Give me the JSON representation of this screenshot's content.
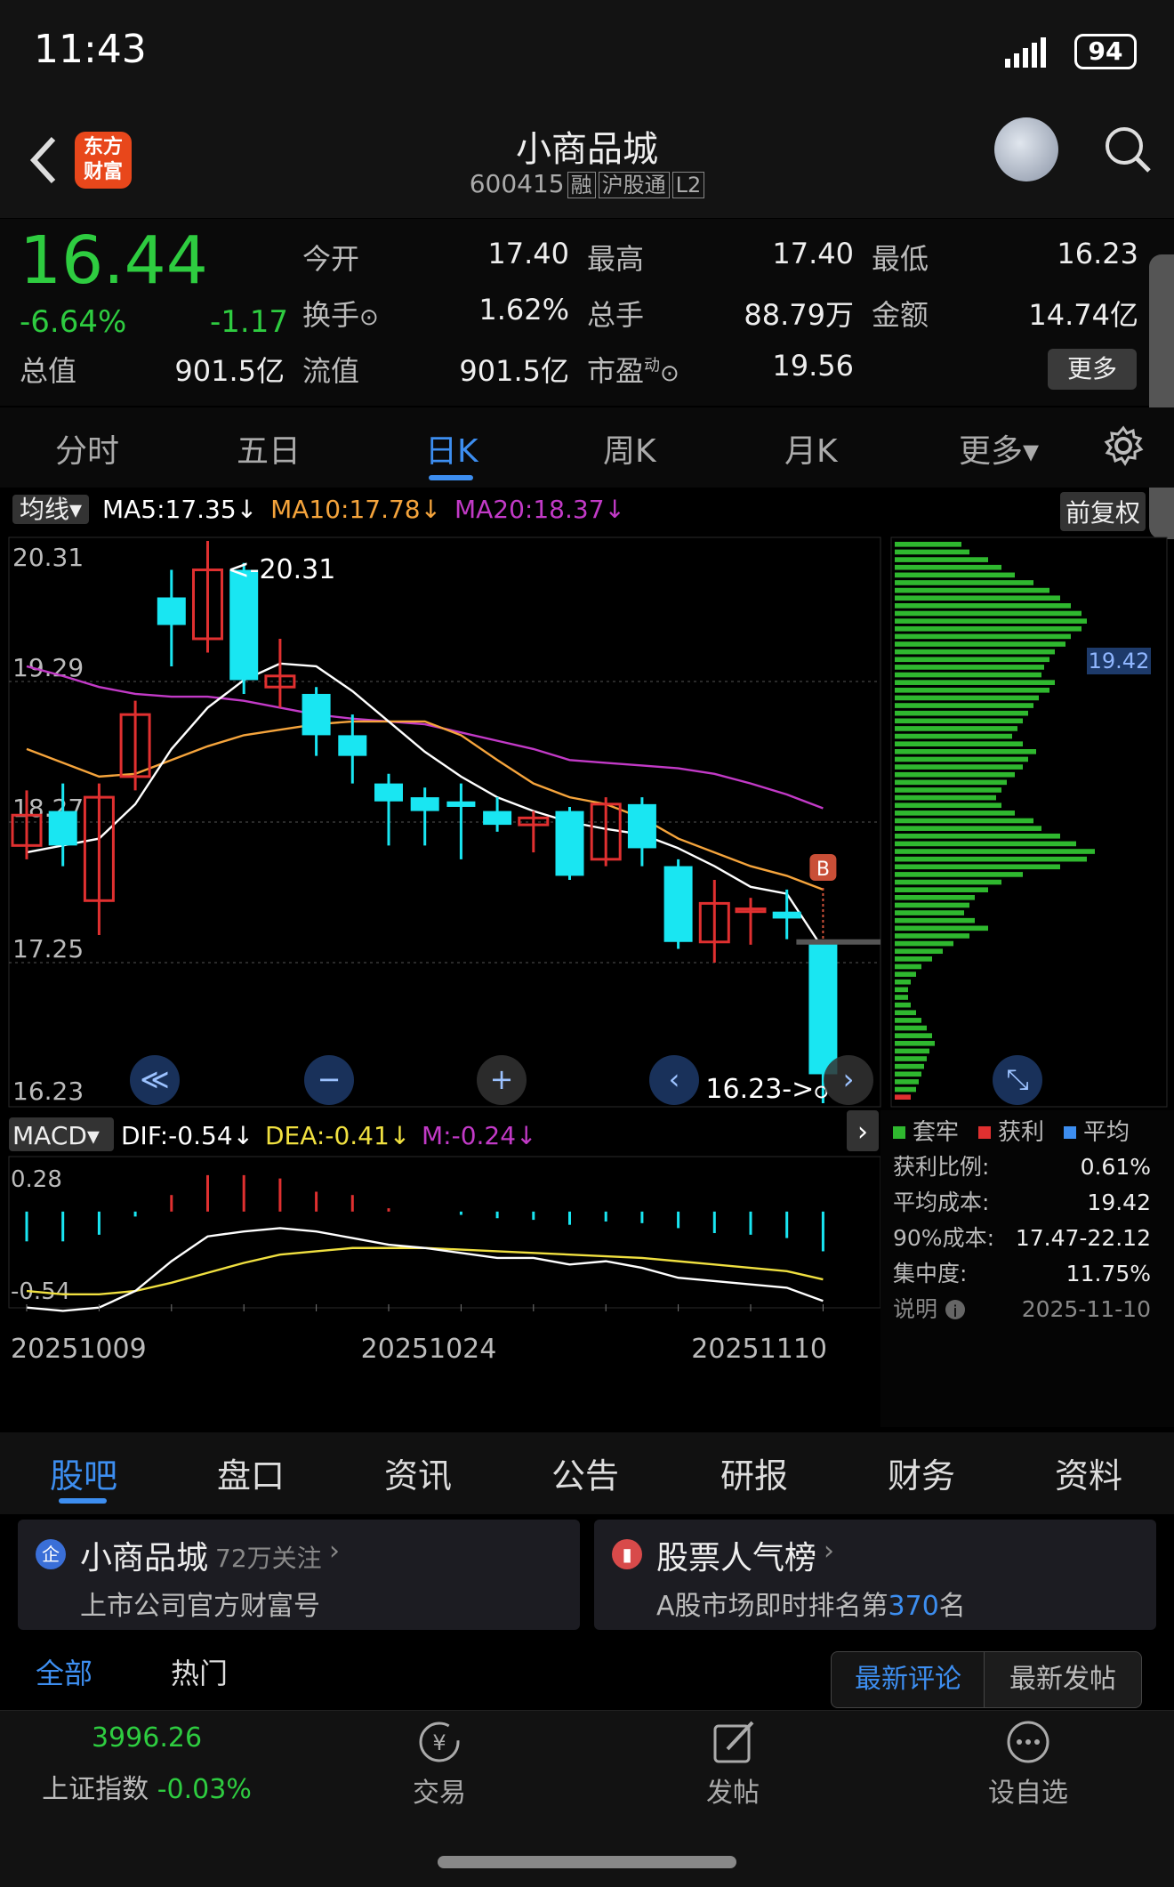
{
  "status_bar": {
    "time": "11:43",
    "battery": "94"
  },
  "header": {
    "name": "小商品城",
    "code": "600415",
    "tags": [
      "融",
      "沪股通",
      "L2"
    ],
    "logo_text": "东方财富"
  },
  "quote": {
    "price": "16.44",
    "change_pct": "-6.64%",
    "change": "-1.17",
    "open_label": "今开",
    "open": "17.40",
    "high_label": "最高",
    "high": "17.40",
    "low_label": "最低",
    "low": "16.23",
    "turnover_label": "换手",
    "turnover": "1.62%",
    "volume_label": "总手",
    "volume": "88.79万",
    "amount_label": "金额",
    "amount": "14.74亿",
    "mktcap_label": "总值",
    "mktcap": "901.5亿",
    "float_label": "流值",
    "float": "901.5亿",
    "pe_label": "市盈",
    "pe_sup": "动",
    "pe": "19.56",
    "more": "更多"
  },
  "period_tabs": [
    "分时",
    "五日",
    "日K",
    "周K",
    "月K",
    "更多▾"
  ],
  "ma_bar": {
    "selector": "均线▾",
    "ma5": "MA5:17.35↓",
    "ma10": "MA10:17.78↓",
    "ma20": "MA20:18.37↓",
    "adjust": "前复权"
  },
  "macd_bar": {
    "selector": "MACD▾",
    "dif": "DIF:-0.54↓",
    "dea": "DEA:-0.41↓",
    "m": "M:-0.24↓"
  },
  "colors": {
    "up": "#e03030",
    "down": "#19e6f2",
    "ma5": "#ffffff",
    "ma10": "#f5a43c",
    "ma20": "#c23ac7",
    "dea": "#f0e040",
    "chip": "#2fb82f"
  },
  "chart_data": {
    "type": "candlestick",
    "price_axis": {
      "ticks": [
        "20.31",
        "19.29",
        "18.27",
        "17.25",
        "16.23"
      ],
      "max_label": "<-20.31",
      "min_label": "16.23->",
      "range": [
        16.23,
        20.31
      ]
    },
    "candles": [
      {
        "o": 18.1,
        "c": 18.32,
        "h": 18.5,
        "l": 18.0
      },
      {
        "o": 18.35,
        "c": 18.1,
        "h": 18.55,
        "l": 17.95
      },
      {
        "o": 17.7,
        "c": 18.45,
        "h": 18.55,
        "l": 17.45
      },
      {
        "o": 18.6,
        "c": 19.05,
        "h": 19.15,
        "l": 18.5
      },
      {
        "o": 19.9,
        "c": 19.7,
        "h": 20.1,
        "l": 19.4
      },
      {
        "o": 19.6,
        "c": 20.1,
        "h": 20.31,
        "l": 19.5
      },
      {
        "o": 20.1,
        "c": 19.3,
        "h": 20.15,
        "l": 19.2
      },
      {
        "o": 19.25,
        "c": 19.33,
        "h": 19.6,
        "l": 19.1
      },
      {
        "o": 19.2,
        "c": 18.9,
        "h": 19.25,
        "l": 18.75
      },
      {
        "o": 18.9,
        "c": 18.75,
        "h": 19.05,
        "l": 18.55
      },
      {
        "o": 18.55,
        "c": 18.42,
        "h": 18.62,
        "l": 18.1
      },
      {
        "o": 18.45,
        "c": 18.35,
        "h": 18.52,
        "l": 18.1
      },
      {
        "o": 18.42,
        "c": 18.38,
        "h": 18.55,
        "l": 18.0
      },
      {
        "o": 18.35,
        "c": 18.25,
        "h": 18.45,
        "l": 18.2
      },
      {
        "o": 18.25,
        "c": 18.3,
        "h": 18.35,
        "l": 18.05
      },
      {
        "o": 18.35,
        "c": 17.88,
        "h": 18.38,
        "l": 17.85
      },
      {
        "o": 18.0,
        "c": 18.4,
        "h": 18.45,
        "l": 17.95
      },
      {
        "o": 18.4,
        "c": 18.08,
        "h": 18.45,
        "l": 17.95
      },
      {
        "o": 17.95,
        "c": 17.4,
        "h": 18.0,
        "l": 17.35
      },
      {
        "o": 17.4,
        "c": 17.68,
        "h": 17.85,
        "l": 17.25
      },
      {
        "o": 17.62,
        "c": 17.64,
        "h": 17.72,
        "l": 17.38
      },
      {
        "o": 17.62,
        "c": 17.57,
        "h": 17.78,
        "l": 17.42
      },
      {
        "o": 17.4,
        "c": 16.44,
        "h": 17.4,
        "l": 16.23
      }
    ],
    "ma5": [
      18.05,
      18.1,
      18.15,
      18.4,
      18.8,
      19.1,
      19.3,
      19.42,
      19.4,
      19.22,
      19.0,
      18.78,
      18.6,
      18.45,
      18.35,
      18.27,
      18.22,
      18.18,
      18.08,
      17.95,
      17.8,
      17.75,
      17.35
    ],
    "ma10": [
      18.8,
      18.7,
      18.6,
      18.62,
      18.72,
      18.82,
      18.9,
      18.94,
      18.98,
      19.0,
      19.0,
      19.0,
      18.9,
      18.72,
      18.55,
      18.45,
      18.4,
      18.3,
      18.15,
      18.05,
      17.95,
      17.88,
      17.78
    ],
    "ma20": [
      19.4,
      19.33,
      19.25,
      19.2,
      19.18,
      19.18,
      19.15,
      19.1,
      19.05,
      19.02,
      19.0,
      18.98,
      18.92,
      18.86,
      18.8,
      18.72,
      18.7,
      18.68,
      18.66,
      18.62,
      18.55,
      18.47,
      18.37
    ],
    "buy_marker": "B",
    "macd": {
      "axis": [
        "0.28",
        "-0.54"
      ],
      "hist": [
        -0.18,
        -0.18,
        -0.14,
        -0.03,
        0.1,
        0.22,
        0.22,
        0.2,
        0.12,
        0.1,
        0.02,
        0.0,
        -0.02,
        -0.04,
        -0.05,
        -0.08,
        -0.06,
        -0.07,
        -0.1,
        -0.13,
        -0.14,
        -0.16,
        -0.24
      ],
      "dif": [
        -0.58,
        -0.6,
        -0.58,
        -0.48,
        -0.3,
        -0.15,
        -0.12,
        -0.1,
        -0.12,
        -0.16,
        -0.2,
        -0.22,
        -0.25,
        -0.28,
        -0.28,
        -0.32,
        -0.3,
        -0.34,
        -0.4,
        -0.42,
        -0.44,
        -0.46,
        -0.54
      ],
      "dea": [
        -0.48,
        -0.5,
        -0.5,
        -0.48,
        -0.43,
        -0.37,
        -0.31,
        -0.26,
        -0.24,
        -0.22,
        -0.22,
        -0.22,
        -0.23,
        -0.24,
        -0.25,
        -0.26,
        -0.27,
        -0.28,
        -0.3,
        -0.32,
        -0.34,
        -0.36,
        -0.41
      ]
    },
    "dates": [
      "20251009",
      "20251024",
      "20251110"
    ]
  },
  "chip": {
    "avg_tag": "19.42",
    "profile": [
      0.25,
      0.28,
      0.35,
      0.4,
      0.45,
      0.52,
      0.58,
      0.62,
      0.66,
      0.7,
      0.72,
      0.7,
      0.66,
      0.64,
      0.6,
      0.58,
      0.56,
      0.55,
      0.6,
      0.58,
      0.54,
      0.52,
      0.5,
      0.48,
      0.46,
      0.44,
      0.48,
      0.53,
      0.5,
      0.48,
      0.45,
      0.42,
      0.4,
      0.38,
      0.4,
      0.45,
      0.52,
      0.55,
      0.62,
      0.68,
      0.75,
      0.72,
      0.62,
      0.48,
      0.4,
      0.35,
      0.3,
      0.28,
      0.26,
      0.3,
      0.35,
      0.28,
      0.22,
      0.18,
      0.14,
      0.1,
      0.08,
      0.06,
      0.05,
      0.05,
      0.06,
      0.08,
      0.1,
      0.12,
      0.14,
      0.15,
      0.13,
      0.12,
      0.11,
      0.1,
      0.09,
      0.08,
      0.06
    ],
    "legend": [
      "套牢",
      "获利",
      "平均"
    ],
    "rows": [
      {
        "label": "获利比例:",
        "value": "0.61%"
      },
      {
        "label": "平均成本:",
        "value": "19.42"
      },
      {
        "label": "90%成本:",
        "value": "17.47-22.12"
      },
      {
        "label": "集中度:",
        "value": "11.75%"
      }
    ],
    "note_label": "说明",
    "date": "2025-11-10"
  },
  "bottom_tabs": [
    "股吧",
    "盘口",
    "资讯",
    "公告",
    "研报",
    "财务",
    "资料"
  ],
  "card_left": {
    "title": "小商品城",
    "followers": "72万关注",
    "sub": "上市公司官方财富号"
  },
  "card_right": {
    "title": "股票人气榜",
    "sub_pre": "A股市场即时排名第",
    "rank": "370",
    "sub_post": "名"
  },
  "filters": {
    "all": "全部",
    "hot": "热门",
    "latest_comment": "最新评论",
    "latest_post": "最新发帖"
  },
  "footer": {
    "index_value": "3996.26",
    "index_name": "上证指数",
    "index_change": "-0.03%",
    "trade": "交易",
    "post": "发帖",
    "watch": "设自选"
  }
}
